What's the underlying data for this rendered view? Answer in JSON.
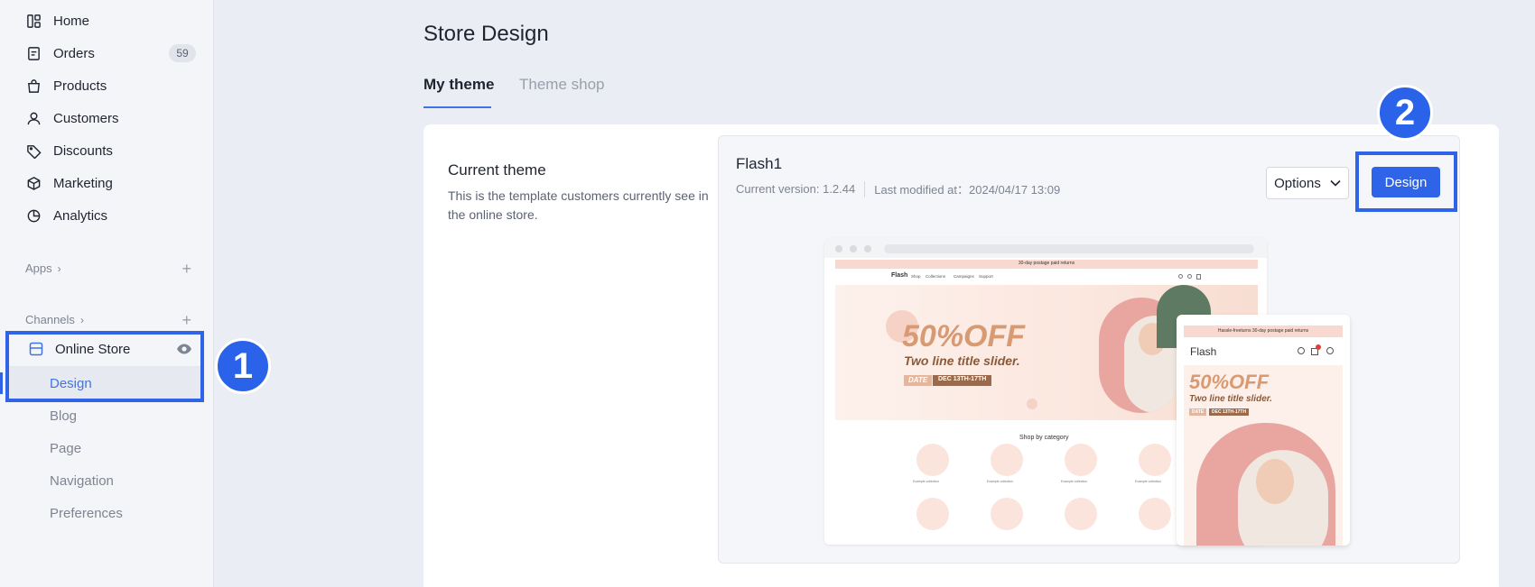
{
  "sidebar": {
    "items": [
      {
        "label": "Home",
        "icon": "home-icon"
      },
      {
        "label": "Orders",
        "icon": "orders-icon",
        "badge": "59"
      },
      {
        "label": "Products",
        "icon": "products-icon"
      },
      {
        "label": "Customers",
        "icon": "customers-icon"
      },
      {
        "label": "Discounts",
        "icon": "discounts-icon"
      },
      {
        "label": "Marketing",
        "icon": "marketing-icon"
      },
      {
        "label": "Analytics",
        "icon": "analytics-icon"
      }
    ],
    "apps_label": "Apps",
    "channels_label": "Channels",
    "online_store_label": "Online Store",
    "sub_items": [
      "Design",
      "Blog",
      "Page",
      "Navigation",
      "Preferences"
    ]
  },
  "callouts": {
    "step1": "1",
    "step2": "2"
  },
  "main": {
    "title": "Store Design",
    "tabs": [
      {
        "label": "My theme",
        "active": true
      },
      {
        "label": "Theme shop",
        "active": false
      }
    ],
    "current_theme": {
      "title": "Current theme",
      "description": "This is the template customers currently see in the online store."
    },
    "theme": {
      "name": "Flash1",
      "version": "Current version: 1.2.44",
      "modified": "Last modified at：2024/04/17 13:09",
      "options_label": "Options",
      "design_label": "Design"
    },
    "preview": {
      "announcement": "30-day postage paid returns",
      "brand": "Flash",
      "nav": [
        "Shop",
        "Collections",
        "Campaigns",
        "Support"
      ],
      "headline": "50%OFF",
      "subheadline": "Two line title slider.",
      "date_label": "DATE",
      "date_range": "DEC 13TH-17TH",
      "shop_by_category": "Shop by category",
      "collection_label": "Example collection",
      "mobile_announcement": "Hassle-freeturns 30-day postage paid returns"
    }
  },
  "colors": {
    "accent": "#2f63e8",
    "sidebar_bg": "#f4f5f8",
    "page_bg": "#eaedf3"
  }
}
